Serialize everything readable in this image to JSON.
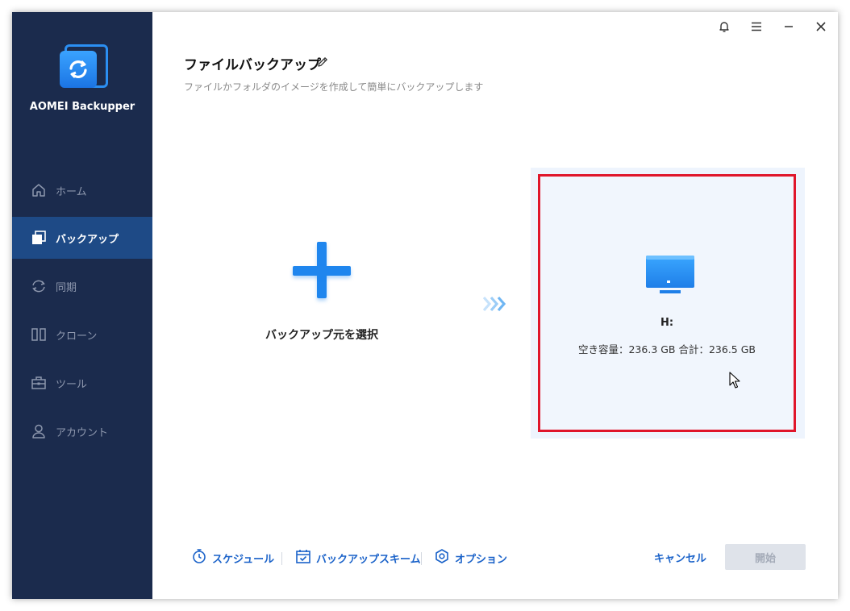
{
  "app": {
    "name": "AOMEI Backupper"
  },
  "sidebar": {
    "items": [
      {
        "label": "ホーム",
        "icon": "home-icon",
        "active": false
      },
      {
        "label": "バックアップ",
        "icon": "backup-icon",
        "active": true
      },
      {
        "label": "同期",
        "icon": "sync-icon",
        "active": false
      },
      {
        "label": "クローン",
        "icon": "clone-icon",
        "active": false
      },
      {
        "label": "ツール",
        "icon": "toolbox-icon",
        "active": false
      },
      {
        "label": "アカウント",
        "icon": "user-icon",
        "active": false
      }
    ]
  },
  "titlebar": {
    "buttons": [
      "bell-icon",
      "menu-icon",
      "minimize-icon",
      "close-icon"
    ]
  },
  "page": {
    "title": "ファイルバックアップ",
    "subtitle": "ファイルかフォルダのイメージを作成して簡単にバックアップします"
  },
  "source": {
    "label": "バックアップ元を選択"
  },
  "destination": {
    "drive": "H:",
    "info": "空き容量：236.3 GB 合計：236.5 GB"
  },
  "footer": {
    "schedule": "スケジュール",
    "scheme": "バックアップスキーム",
    "options": "オプション",
    "cancel": "キャンセル",
    "start": "開始"
  },
  "colors": {
    "sidebar_bg": "#1b2b4d",
    "sidebar_active": "#1e4a86",
    "accent": "#1f86ee",
    "highlight_border": "#e0162b",
    "link": "#1a62c9"
  }
}
